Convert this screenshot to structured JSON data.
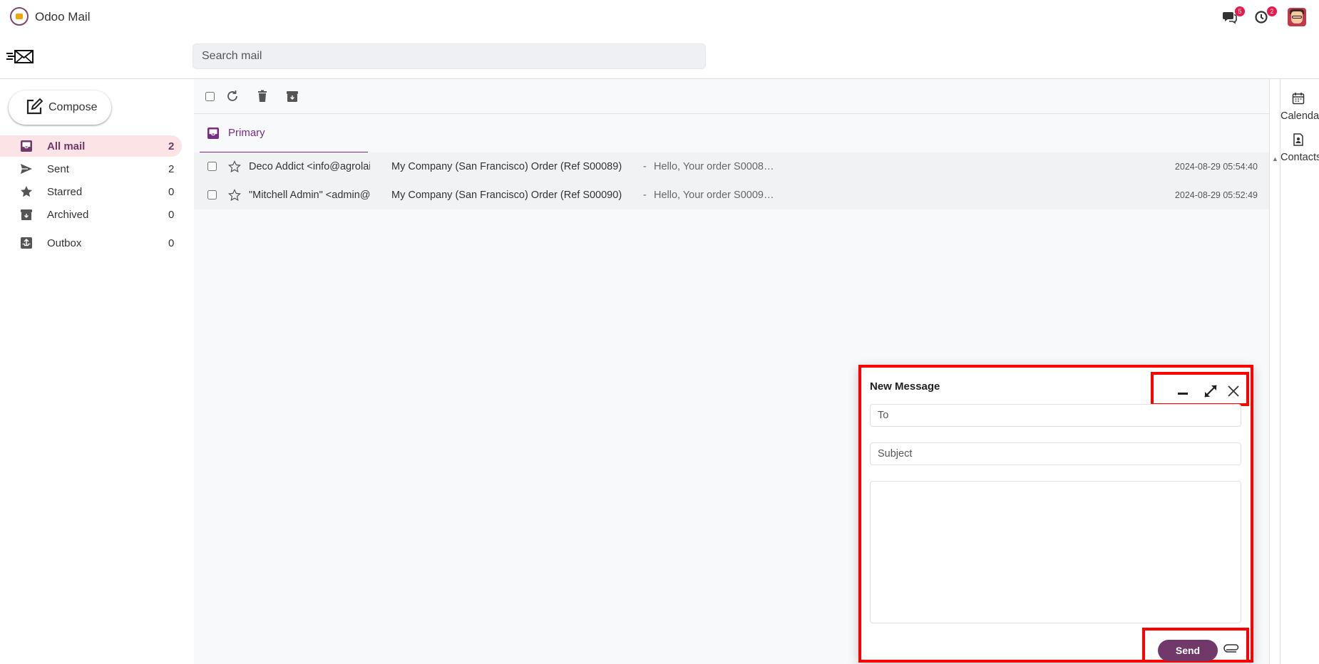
{
  "app": {
    "title": "Odoo Mail"
  },
  "header": {
    "chat_count": "5",
    "activity_count": "2"
  },
  "search": {
    "placeholder": "Search mail"
  },
  "sidebar": {
    "compose_label": "Compose",
    "items": [
      {
        "label": "All mail",
        "count": "2",
        "icon": "inbox-icon"
      },
      {
        "label": "Sent",
        "count": "2",
        "icon": "send-icon"
      },
      {
        "label": "Starred",
        "count": "0",
        "icon": "star-icon"
      },
      {
        "label": "Archived",
        "count": "0",
        "icon": "archive-icon"
      },
      {
        "label": "Outbox",
        "count": "0",
        "icon": "outbox-icon"
      }
    ]
  },
  "tabs": {
    "primary_label": "Primary"
  },
  "messages": [
    {
      "from": "Deco Addict <info@agrolait.com>",
      "subject": "My Company (San Francisco) Order (Ref S00089)",
      "snippet": "Hello, Your order S0008…",
      "date": "2024-08-29 05:54:40"
    },
    {
      "from": "\"Mitchell Admin\" <admin@yourcompany.example.com>",
      "subject": "My Company (San Francisco) Order (Ref S00090)",
      "snippet": "Hello, Your order S0009…",
      "date": "2024-08-29 05:52:49"
    }
  ],
  "message_separator": "-",
  "rail": {
    "calendar_label": "Calendar",
    "contacts_label": "Contacts"
  },
  "compose_dialog": {
    "title": "New Message",
    "to_placeholder": "To",
    "subject_placeholder": "Subject",
    "send_label": "Send"
  },
  "colors": {
    "brand": "#71396a",
    "active_bg": "#fbe3e6",
    "tab_accent": "#7c2a8a",
    "highlight_box": "#ff0000",
    "badge": "#e8194b"
  }
}
